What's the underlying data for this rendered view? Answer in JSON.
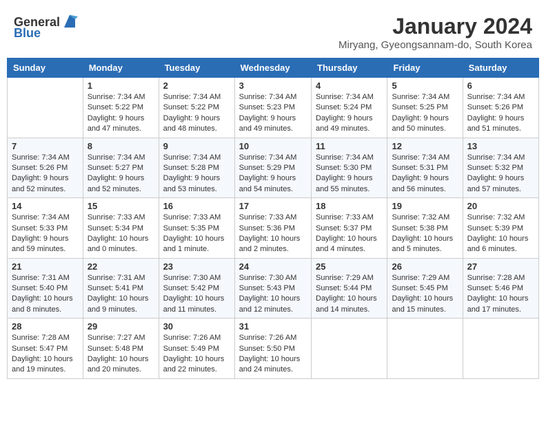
{
  "header": {
    "logo_general": "General",
    "logo_blue": "Blue",
    "month_title": "January 2024",
    "subtitle": "Miryang, Gyeongsannam-do, South Korea"
  },
  "weekdays": [
    "Sunday",
    "Monday",
    "Tuesday",
    "Wednesday",
    "Thursday",
    "Friday",
    "Saturday"
  ],
  "weeks": [
    [
      {
        "day": "",
        "info": ""
      },
      {
        "day": "1",
        "info": "Sunrise: 7:34 AM\nSunset: 5:22 PM\nDaylight: 9 hours\nand 47 minutes."
      },
      {
        "day": "2",
        "info": "Sunrise: 7:34 AM\nSunset: 5:22 PM\nDaylight: 9 hours\nand 48 minutes."
      },
      {
        "day": "3",
        "info": "Sunrise: 7:34 AM\nSunset: 5:23 PM\nDaylight: 9 hours\nand 49 minutes."
      },
      {
        "day": "4",
        "info": "Sunrise: 7:34 AM\nSunset: 5:24 PM\nDaylight: 9 hours\nand 49 minutes."
      },
      {
        "day": "5",
        "info": "Sunrise: 7:34 AM\nSunset: 5:25 PM\nDaylight: 9 hours\nand 50 minutes."
      },
      {
        "day": "6",
        "info": "Sunrise: 7:34 AM\nSunset: 5:26 PM\nDaylight: 9 hours\nand 51 minutes."
      }
    ],
    [
      {
        "day": "7",
        "info": "Sunrise: 7:34 AM\nSunset: 5:26 PM\nDaylight: 9 hours\nand 52 minutes."
      },
      {
        "day": "8",
        "info": "Sunrise: 7:34 AM\nSunset: 5:27 PM\nDaylight: 9 hours\nand 52 minutes."
      },
      {
        "day": "9",
        "info": "Sunrise: 7:34 AM\nSunset: 5:28 PM\nDaylight: 9 hours\nand 53 minutes."
      },
      {
        "day": "10",
        "info": "Sunrise: 7:34 AM\nSunset: 5:29 PM\nDaylight: 9 hours\nand 54 minutes."
      },
      {
        "day": "11",
        "info": "Sunrise: 7:34 AM\nSunset: 5:30 PM\nDaylight: 9 hours\nand 55 minutes."
      },
      {
        "day": "12",
        "info": "Sunrise: 7:34 AM\nSunset: 5:31 PM\nDaylight: 9 hours\nand 56 minutes."
      },
      {
        "day": "13",
        "info": "Sunrise: 7:34 AM\nSunset: 5:32 PM\nDaylight: 9 hours\nand 57 minutes."
      }
    ],
    [
      {
        "day": "14",
        "info": "Sunrise: 7:34 AM\nSunset: 5:33 PM\nDaylight: 9 hours\nand 59 minutes."
      },
      {
        "day": "15",
        "info": "Sunrise: 7:33 AM\nSunset: 5:34 PM\nDaylight: 10 hours\nand 0 minutes."
      },
      {
        "day": "16",
        "info": "Sunrise: 7:33 AM\nSunset: 5:35 PM\nDaylight: 10 hours\nand 1 minute."
      },
      {
        "day": "17",
        "info": "Sunrise: 7:33 AM\nSunset: 5:36 PM\nDaylight: 10 hours\nand 2 minutes."
      },
      {
        "day": "18",
        "info": "Sunrise: 7:33 AM\nSunset: 5:37 PM\nDaylight: 10 hours\nand 4 minutes."
      },
      {
        "day": "19",
        "info": "Sunrise: 7:32 AM\nSunset: 5:38 PM\nDaylight: 10 hours\nand 5 minutes."
      },
      {
        "day": "20",
        "info": "Sunrise: 7:32 AM\nSunset: 5:39 PM\nDaylight: 10 hours\nand 6 minutes."
      }
    ],
    [
      {
        "day": "21",
        "info": "Sunrise: 7:31 AM\nSunset: 5:40 PM\nDaylight: 10 hours\nand 8 minutes."
      },
      {
        "day": "22",
        "info": "Sunrise: 7:31 AM\nSunset: 5:41 PM\nDaylight: 10 hours\nand 9 minutes."
      },
      {
        "day": "23",
        "info": "Sunrise: 7:30 AM\nSunset: 5:42 PM\nDaylight: 10 hours\nand 11 minutes."
      },
      {
        "day": "24",
        "info": "Sunrise: 7:30 AM\nSunset: 5:43 PM\nDaylight: 10 hours\nand 12 minutes."
      },
      {
        "day": "25",
        "info": "Sunrise: 7:29 AM\nSunset: 5:44 PM\nDaylight: 10 hours\nand 14 minutes."
      },
      {
        "day": "26",
        "info": "Sunrise: 7:29 AM\nSunset: 5:45 PM\nDaylight: 10 hours\nand 15 minutes."
      },
      {
        "day": "27",
        "info": "Sunrise: 7:28 AM\nSunset: 5:46 PM\nDaylight: 10 hours\nand 17 minutes."
      }
    ],
    [
      {
        "day": "28",
        "info": "Sunrise: 7:28 AM\nSunset: 5:47 PM\nDaylight: 10 hours\nand 19 minutes."
      },
      {
        "day": "29",
        "info": "Sunrise: 7:27 AM\nSunset: 5:48 PM\nDaylight: 10 hours\nand 20 minutes."
      },
      {
        "day": "30",
        "info": "Sunrise: 7:26 AM\nSunset: 5:49 PM\nDaylight: 10 hours\nand 22 minutes."
      },
      {
        "day": "31",
        "info": "Sunrise: 7:26 AM\nSunset: 5:50 PM\nDaylight: 10 hours\nand 24 minutes."
      },
      {
        "day": "",
        "info": ""
      },
      {
        "day": "",
        "info": ""
      },
      {
        "day": "",
        "info": ""
      }
    ]
  ]
}
